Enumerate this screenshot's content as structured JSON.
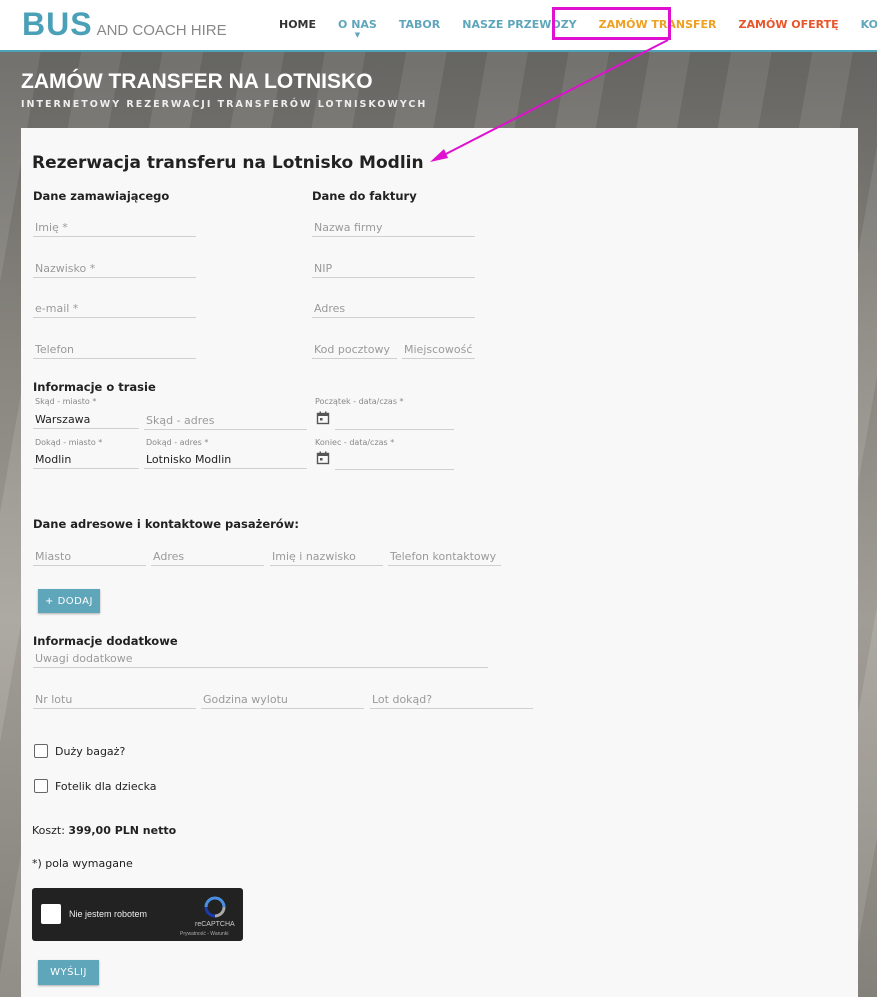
{
  "header": {
    "logo_big": "BUS",
    "logo_small": "AND COACH HIRE",
    "nav": [
      "HOME",
      "O NAS",
      "TABOR",
      "NASZE PRZEWOZY",
      "ZAMÓW TRANSFER",
      "ZAMÓW OFERTĘ",
      "KONTAKT"
    ],
    "colors": {
      "accent": "#4fa3b8",
      "active": "#f0a020",
      "offer": "#e8552b",
      "highlight": "#e010d0"
    }
  },
  "page": {
    "title": "ZAMÓW TRANSFER NA LOTNISKO",
    "subtitle": "INTERNETOWY REZERWACJI TRANSFERÓW LOTNISKOWYCH"
  },
  "form": {
    "heading": "Rezerwacja transferu na Lotnisko Modlin",
    "orderer": {
      "title": "Dane zamawiającego",
      "first_name": "Imię *",
      "last_name": "Nazwisko *",
      "email": "e-mail *",
      "phone": "Telefon"
    },
    "invoice": {
      "title": "Dane do faktury",
      "company": "Nazwa firmy",
      "nip": "NIP",
      "address": "Adres",
      "postal": "Kod pocztowy",
      "city": "Miejscowość"
    },
    "route": {
      "title": "Informacje o trasie",
      "from_city_label": "Skąd - miasto *",
      "from_city_value": "Warszawa",
      "from_address": "Skąd - adres",
      "start_label": "Początek - data/czas *",
      "to_city_label": "Dokąd - miasto *",
      "to_city_value": "Modlin",
      "to_address_label": "Dokąd - adres *",
      "to_address_value": "Lotnisko Modlin",
      "end_label": "Koniec - data/czas *"
    },
    "passengers": {
      "title": "Dane adresowe i kontaktowe pasażerów:",
      "city": "Miasto",
      "address": "Adres",
      "name": "Imię i nazwisko",
      "phone": "Telefon kontaktowy",
      "add_button": "+ DODAJ"
    },
    "extra": {
      "title": "Informacje dodatkowe",
      "notes": "Uwagi dodatkowe",
      "flight_no": "Nr lotu",
      "departure_time": "Godzina wylotu",
      "destination": "Lot dokąd?",
      "big_luggage": "Duży bagaż?",
      "child_seat": "Fotelik dla dziecka"
    },
    "cost_label": "Koszt:",
    "cost_value": "399,00 PLN netto",
    "required_note": "*) pola wymagane",
    "recaptcha": {
      "label": "Nie jestem robotem",
      "brand": "reCAPTCHA",
      "terms": "Prywatność - Warunki"
    },
    "submit": "WYŚLIJ"
  }
}
